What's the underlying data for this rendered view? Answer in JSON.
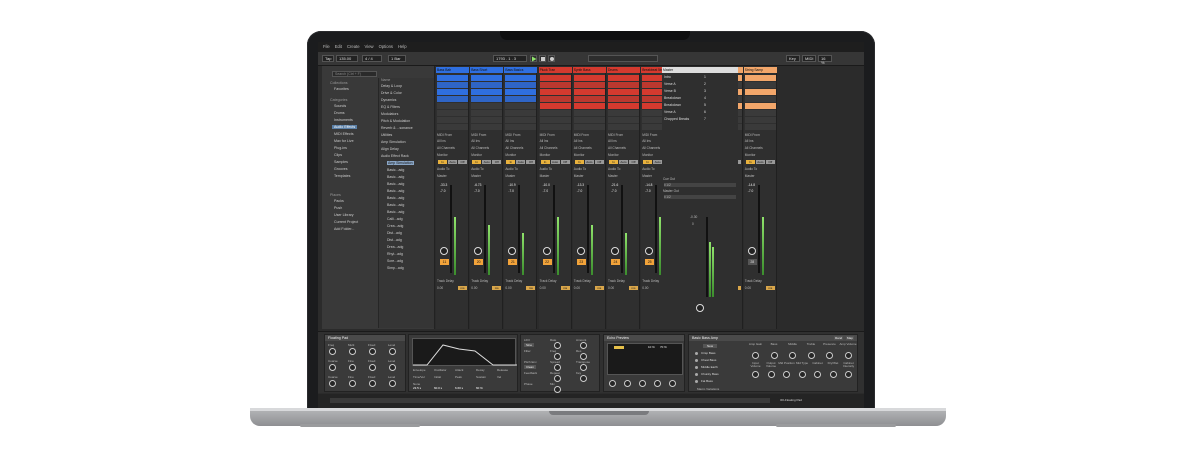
{
  "menu": [
    "File",
    "Edit",
    "Create",
    "View",
    "Options",
    "Help"
  ],
  "transport": {
    "tap": "Tap",
    "tempo": "135.00",
    "sig": "4 / 4",
    "bar": "1 Bar",
    "pos": "1793 . 1 . 3",
    "key": "Key",
    "midi": "MIDI",
    "cpu": "16 %"
  },
  "browser": {
    "search_placeholder": "Search (Ctrl + F)",
    "collections_title": "Collections",
    "favorites": "Favorites",
    "categories_title": "Categories",
    "categories": [
      "Sounds",
      "Drums",
      "Instruments",
      "Audio Effects",
      "MIDI Effects",
      "Max for Live",
      "Plug-ins",
      "Clips",
      "Samples",
      "Grooves",
      "Templates"
    ],
    "places_title": "Places",
    "places": [
      "Packs",
      "Push",
      "User Library",
      "Current Project",
      "Add Folder..."
    ],
    "name_header": "Name",
    "names": [
      "Delay & Loop",
      "Drive & Color",
      "Dynamics",
      "EQ & Filters",
      "Modulators",
      "Pitch & Modulation",
      "Reverb & ...sonance",
      "Utilities",
      "Amp Simulation",
      "Align Delay",
      "Audio Effect Rack",
      "Amp Simulation",
      "Basic...adg",
      "Basic...adg",
      "Basic...adg",
      "Basic...adg",
      "Basic...adg",
      "Basic...adg",
      "Basic...adg",
      "Calli...adg",
      "Crea...adg",
      "Dist...adg",
      "Dist...adg",
      "Drea...adg",
      "Rhyt...adg",
      "Scre...adg",
      "Simp...adg"
    ]
  },
  "tracks": [
    {
      "name": "Bass Bah",
      "color": "#2f6fe0",
      "vol": "-33.3",
      "pan": "-7.0",
      "num": "11"
    },
    {
      "name": "Bass Short",
      "color": "#2f6fe0",
      "vol": "-6.73",
      "pan": "-7.0",
      "num": "20"
    },
    {
      "name": "Bass Basics",
      "color": "#2f6fe0",
      "vol": "-10.9",
      "pan": "-7.0",
      "num": "21"
    },
    {
      "name": "Pluck Tran",
      "color": "#d43a2f",
      "vol": "-10.0",
      "pan": "-7.0",
      "num": "22"
    },
    {
      "name": "Synth Bass",
      "color": "#d43a2f",
      "vol": "-13.3",
      "pan": "-7.0",
      "num": "23"
    },
    {
      "name": "Drums",
      "color": "#d43a2f",
      "vol": "-21.6",
      "pan": "-7.0",
      "num": "24"
    },
    {
      "name": "Breakbeat 5bt",
      "color": "#d43a2f",
      "vol": "-14.8",
      "pan": "-7.0",
      "num": "25"
    },
    {
      "name": "Vocal Synth",
      "color": "#d43a2f",
      "vol": "-14.8",
      "pan": "-7.0",
      "num": "26"
    },
    {
      "name": "Breakdown Pa",
      "color": "#f2a66a",
      "vol": "-14.8",
      "pan": "-7.0",
      "num": "27"
    },
    {
      "name": "String Samp",
      "color": "#f2a66a",
      "vol": "-14.8",
      "pan": "-7.0",
      "num": "28"
    }
  ],
  "track_labels": {
    "midi_from": "MIDI From",
    "all_ins": "All Ins",
    "all_channels": "All Channels",
    "monitor": "Monitor",
    "in": "In",
    "auto": "Auto",
    "off": "Off",
    "audio_to": "Audio To",
    "master": "Master",
    "track_delay": "Track Delay",
    "ms": "ms",
    "zero": "0.00"
  },
  "master": {
    "title": "Master",
    "scenes": [
      {
        "name": "Intro",
        "n": "1"
      },
      {
        "name": "Verse A",
        "n": "2"
      },
      {
        "name": "Verse B",
        "n": "3"
      },
      {
        "name": "Breakdown",
        "n": "4"
      },
      {
        "name": "Breakdown",
        "n": "5"
      },
      {
        "name": "Verse A",
        "n": "6"
      },
      {
        "name": "Chopped Breaks",
        "n": "7"
      }
    ],
    "cue_out": "Cue Out",
    "cue_val": "ii 1/2",
    "master_out": "Master Out",
    "master_val": "ii 1/2",
    "vol": "-0.30",
    "pan": "0"
  },
  "devices": {
    "drifting": {
      "title": "Floating Pad",
      "labels": [
        "Freq",
        "Multi",
        "Fixed",
        "Level",
        "Coarse",
        "Fine",
        "Fixed",
        "Level",
        "Coarse",
        "Fine",
        "Fixed",
        "Level"
      ]
    },
    "env": {
      "labels": [
        "Envelope",
        "Oscillator",
        "Attack",
        "Decay",
        "Release",
        "Time/Vel",
        "Initial",
        "Peak",
        "Sustain",
        "Vel",
        "None"
      ],
      "vals": [
        "23.5 s",
        "60.0 s",
        "6.60 s",
        "60 %",
        "-50 dB",
        "-23 dB",
        "0.0 dB",
        "0 %"
      ]
    },
    "lfo": {
      "labels": [
        "LFO",
        "Rate",
        "Amount",
        "Filter",
        "Freq",
        "Res",
        "Pitch Env",
        "Spread",
        "Transpose",
        "Feedback",
        "Repeat",
        "Key",
        "Phase",
        "Mix"
      ],
      "sel": "Sine",
      "filter": "Clean"
    },
    "echo": {
      "title": "Echo Preview",
      "vals": [
        "10 %",
        "70 %"
      ]
    },
    "amp": {
      "title": "Basic Bass Amp",
      "presets": [
        "Crisp Bass",
        "Chest Bass",
        "Middle Earth",
        "Chunky Bass",
        "Fat Bass"
      ],
      "macro": "Macro Variations",
      "controls": [
        "Amp Gain",
        "Bass",
        "Middle",
        "Treble",
        "Presence",
        "Amp Volume",
        "Input Volume",
        "Output Volume",
        "Mid Position",
        "Mid Type",
        "Cabinet",
        "Dry/Wet",
        "Cabinet Intensity"
      ],
      "new": "New",
      "rand": "Rand",
      "map": "Map"
    }
  },
  "status": {
    "right": "3O-Floating Pad"
  }
}
